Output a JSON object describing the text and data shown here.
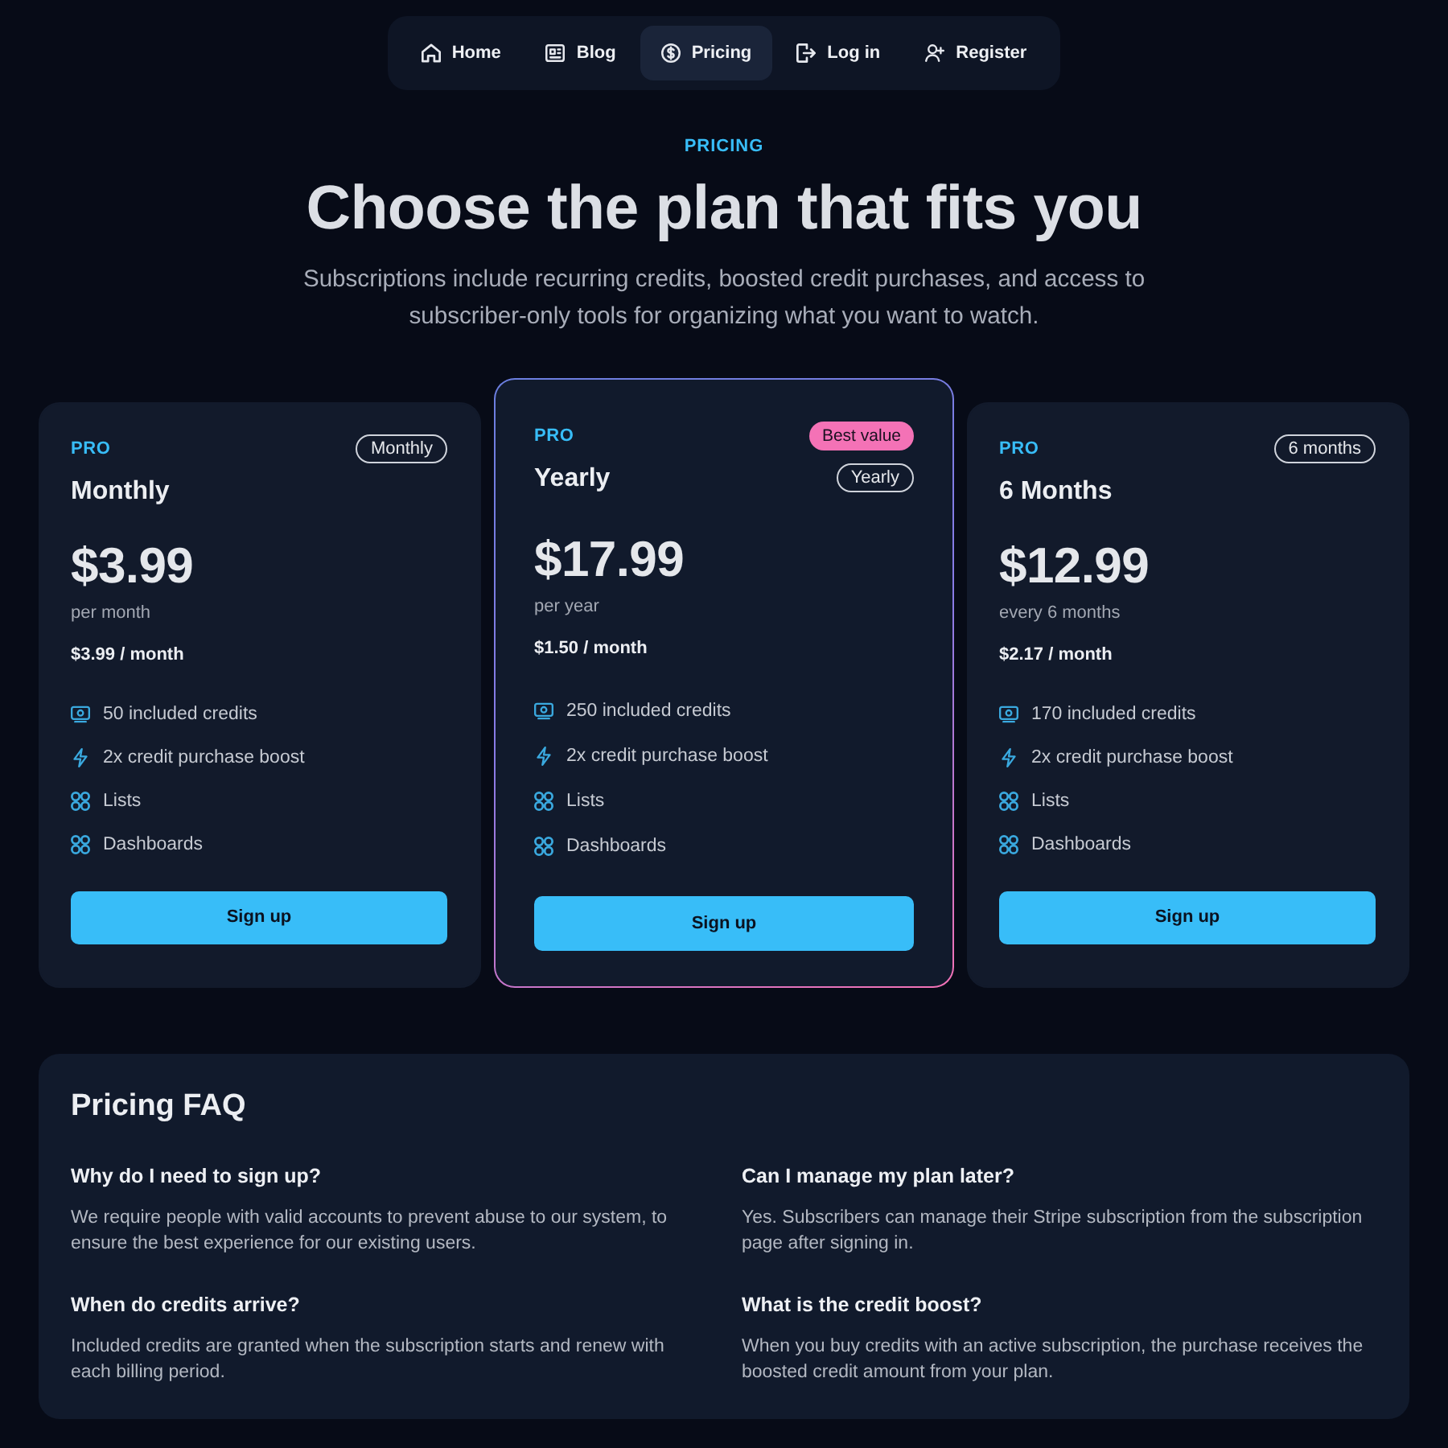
{
  "nav": {
    "items": [
      {
        "kind": "home",
        "label": "Home",
        "selected": false
      },
      {
        "kind": "blog",
        "label": "Blog",
        "selected": false
      },
      {
        "kind": "pricing",
        "label": "Pricing",
        "selected": true
      },
      {
        "kind": "login",
        "label": "Log in",
        "selected": false
      },
      {
        "kind": "register",
        "label": "Register",
        "selected": false
      }
    ]
  },
  "hero": {
    "eyebrow": "PRICING",
    "title": "Choose the plan that fits you",
    "subtitle": "Subscriptions include recurring credits, boosted credit purchases, and access to subscriber-only tools for organizing what you want to watch."
  },
  "plans": [
    {
      "tier": "PRO",
      "name": "Monthly",
      "period_badge": "Monthly",
      "featured": false,
      "price": "$3.99",
      "price_note": "per month",
      "monthly_rate": "$3.99 / month",
      "features": [
        {
          "kind": "credits",
          "label": "50 included credits"
        },
        {
          "kind": "boost",
          "label": "2x credit purchase boost"
        },
        {
          "kind": "tool",
          "label": "Lists"
        },
        {
          "kind": "tool",
          "label": "Dashboards"
        }
      ],
      "button": "Sign up"
    },
    {
      "tier": "PRO",
      "name": "Yearly",
      "highlight_badge": "Best value",
      "period_badge": "Yearly",
      "featured": true,
      "price": "$17.99",
      "price_note": "per year",
      "monthly_rate": "$1.50 / month",
      "features": [
        {
          "kind": "credits",
          "label": "250 included credits"
        },
        {
          "kind": "boost",
          "label": "2x credit purchase boost"
        },
        {
          "kind": "tool",
          "label": "Lists"
        },
        {
          "kind": "tool",
          "label": "Dashboards"
        }
      ],
      "button": "Sign up"
    },
    {
      "tier": "PRO",
      "name": "6 Months",
      "period_badge": "6 months",
      "featured": false,
      "price": "$12.99",
      "price_note": "every 6 months",
      "monthly_rate": "$2.17 / month",
      "features": [
        {
          "kind": "credits",
          "label": "170 included credits"
        },
        {
          "kind": "boost",
          "label": "2x credit purchase boost"
        },
        {
          "kind": "tool",
          "label": "Lists"
        },
        {
          "kind": "tool",
          "label": "Dashboards"
        }
      ],
      "button": "Sign up"
    }
  ],
  "faq": {
    "title": "Pricing FAQ",
    "items": [
      {
        "question": "Why do I need to sign up?",
        "answer": "We require people with valid accounts to prevent abuse to our system, to ensure the best experience for our existing users."
      },
      {
        "question": "Can I manage my plan later?",
        "answer": "Yes. Subscribers can manage their Stripe subscription from the subscription page after signing in."
      },
      {
        "question": "When do credits arrive?",
        "answer": "Included credits are granted when the subscription starts and renew with each billing period."
      },
      {
        "question": "What is the credit boost?",
        "answer": "When you buy credits with an active subscription, the purchase receives the boosted credit amount from your plan."
      }
    ]
  }
}
